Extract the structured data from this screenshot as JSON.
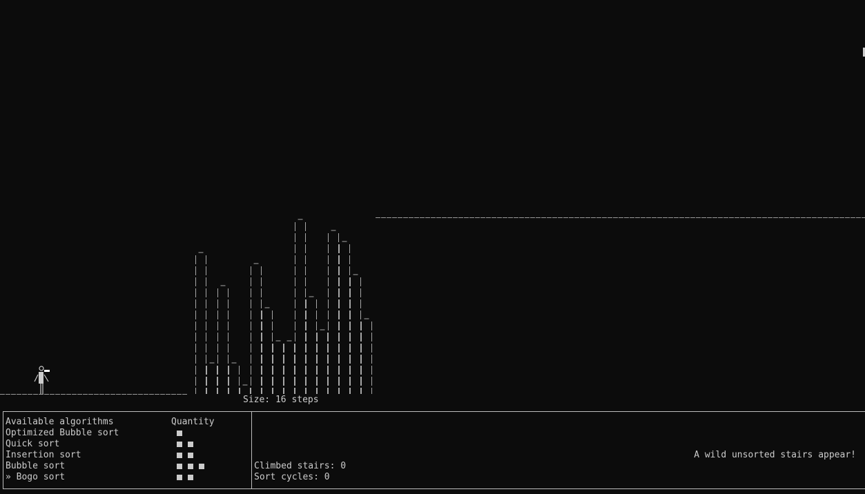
{
  "level": {
    "size_label": "Size: 16 steps",
    "step_heights": [
      13,
      3,
      10,
      3,
      1,
      12,
      8,
      5,
      5,
      16,
      9,
      6,
      15,
      14,
      11,
      7
    ]
  },
  "algorithms_panel": {
    "header_name": "Available algorithms",
    "header_quantity": "Quantity",
    "items": [
      {
        "label": "Optimized Bubble sort",
        "quantity": 1
      },
      {
        "label": "Quick sort",
        "quantity": 2
      },
      {
        "label": "Insertion sort",
        "quantity": 2
      },
      {
        "label": "Bubble sort",
        "quantity": 3
      },
      {
        "label": "» Bogo sort",
        "quantity": 2
      }
    ]
  },
  "status_panel": {
    "message": "A wild unsorted stairs appear!",
    "climbed_stairs": "Climbed stairs: 0",
    "sort_cycles": "Sort cycles: 0"
  },
  "colors": {
    "background": "#0c0c0c",
    "foreground": "#cccccc"
  }
}
